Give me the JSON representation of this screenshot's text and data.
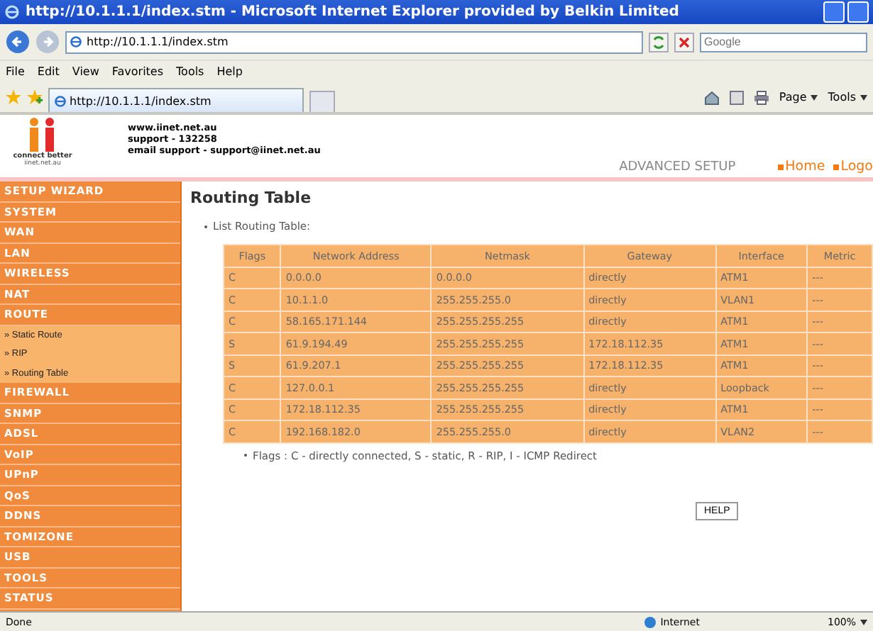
{
  "window": {
    "title": "http://10.1.1.1/index.stm - Microsoft Internet Explorer provided by Belkin Limited"
  },
  "address_bar": {
    "url": "http://10.1.1.1/index.stm",
    "search_placeholder": "Google"
  },
  "menu": [
    "File",
    "Edit",
    "View",
    "Favorites",
    "Tools",
    "Help"
  ],
  "tab": {
    "label": "http://10.1.1.1/index.stm"
  },
  "command_bar": [
    "Page",
    "Tools"
  ],
  "header": {
    "logo_tagline": "connect better",
    "logo_site": "iinet.net.au",
    "contact": [
      "www.iinet.net.au",
      "support - 132258",
      "email support - support@iinet.net.au"
    ],
    "mode": "ADVANCED SETUP",
    "links": [
      "Home",
      "Logo"
    ]
  },
  "sidebar": {
    "items": [
      {
        "label": "SETUP WIZARD",
        "kind": "section"
      },
      {
        "label": "SYSTEM",
        "kind": "section"
      },
      {
        "label": "WAN",
        "kind": "section"
      },
      {
        "label": "LAN",
        "kind": "section"
      },
      {
        "label": "WIRELESS",
        "kind": "section"
      },
      {
        "label": "NAT",
        "kind": "section"
      },
      {
        "label": "ROUTE",
        "kind": "section"
      },
      {
        "label": "» Static Route",
        "kind": "sub"
      },
      {
        "label": "» RIP",
        "kind": "sub"
      },
      {
        "label": "» Routing Table",
        "kind": "sub"
      },
      {
        "label": "FIREWALL",
        "kind": "section"
      },
      {
        "label": "SNMP",
        "kind": "section"
      },
      {
        "label": "ADSL",
        "kind": "section"
      },
      {
        "label": "VoIP",
        "kind": "section"
      },
      {
        "label": "UPnP",
        "kind": "section"
      },
      {
        "label": "QoS",
        "kind": "section"
      },
      {
        "label": "DDNS",
        "kind": "section"
      },
      {
        "label": "TOMIZONE",
        "kind": "section"
      },
      {
        "label": "USB",
        "kind": "section"
      },
      {
        "label": "TOOLS",
        "kind": "section"
      },
      {
        "label": "STATUS",
        "kind": "section"
      }
    ]
  },
  "content": {
    "title": "Routing Table",
    "intro": "List Routing Table:",
    "table": {
      "columns": [
        "Flags",
        "Network Address",
        "Netmask",
        "Gateway",
        "Interface",
        "Metric"
      ],
      "rows": [
        [
          "C",
          "0.0.0.0",
          "0.0.0.0",
          "directly",
          "ATM1",
          "---"
        ],
        [
          "C",
          "10.1.1.0",
          "255.255.255.0",
          "directly",
          "VLAN1",
          "---"
        ],
        [
          "C",
          "58.165.171.144",
          "255.255.255.255",
          "directly",
          "ATM1",
          "---"
        ],
        [
          "S",
          "61.9.194.49",
          "255.255.255.255",
          "172.18.112.35",
          "ATM1",
          "---"
        ],
        [
          "S",
          "61.9.207.1",
          "255.255.255.255",
          "172.18.112.35",
          "ATM1",
          "---"
        ],
        [
          "C",
          "127.0.0.1",
          "255.255.255.255",
          "directly",
          "Loopback",
          "---"
        ],
        [
          "C",
          "172.18.112.35",
          "255.255.255.255",
          "directly",
          "ATM1",
          "---"
        ],
        [
          "C",
          "192.168.182.0",
          "255.255.255.0",
          "directly",
          "VLAN2",
          "---"
        ]
      ]
    },
    "note": "Flags :  C - directly connected, S - static, R - RIP, I - ICMP Redirect",
    "help_button": "HELP"
  },
  "status_bar": {
    "text": "Done",
    "zone": "Internet",
    "zoom": "100%"
  }
}
